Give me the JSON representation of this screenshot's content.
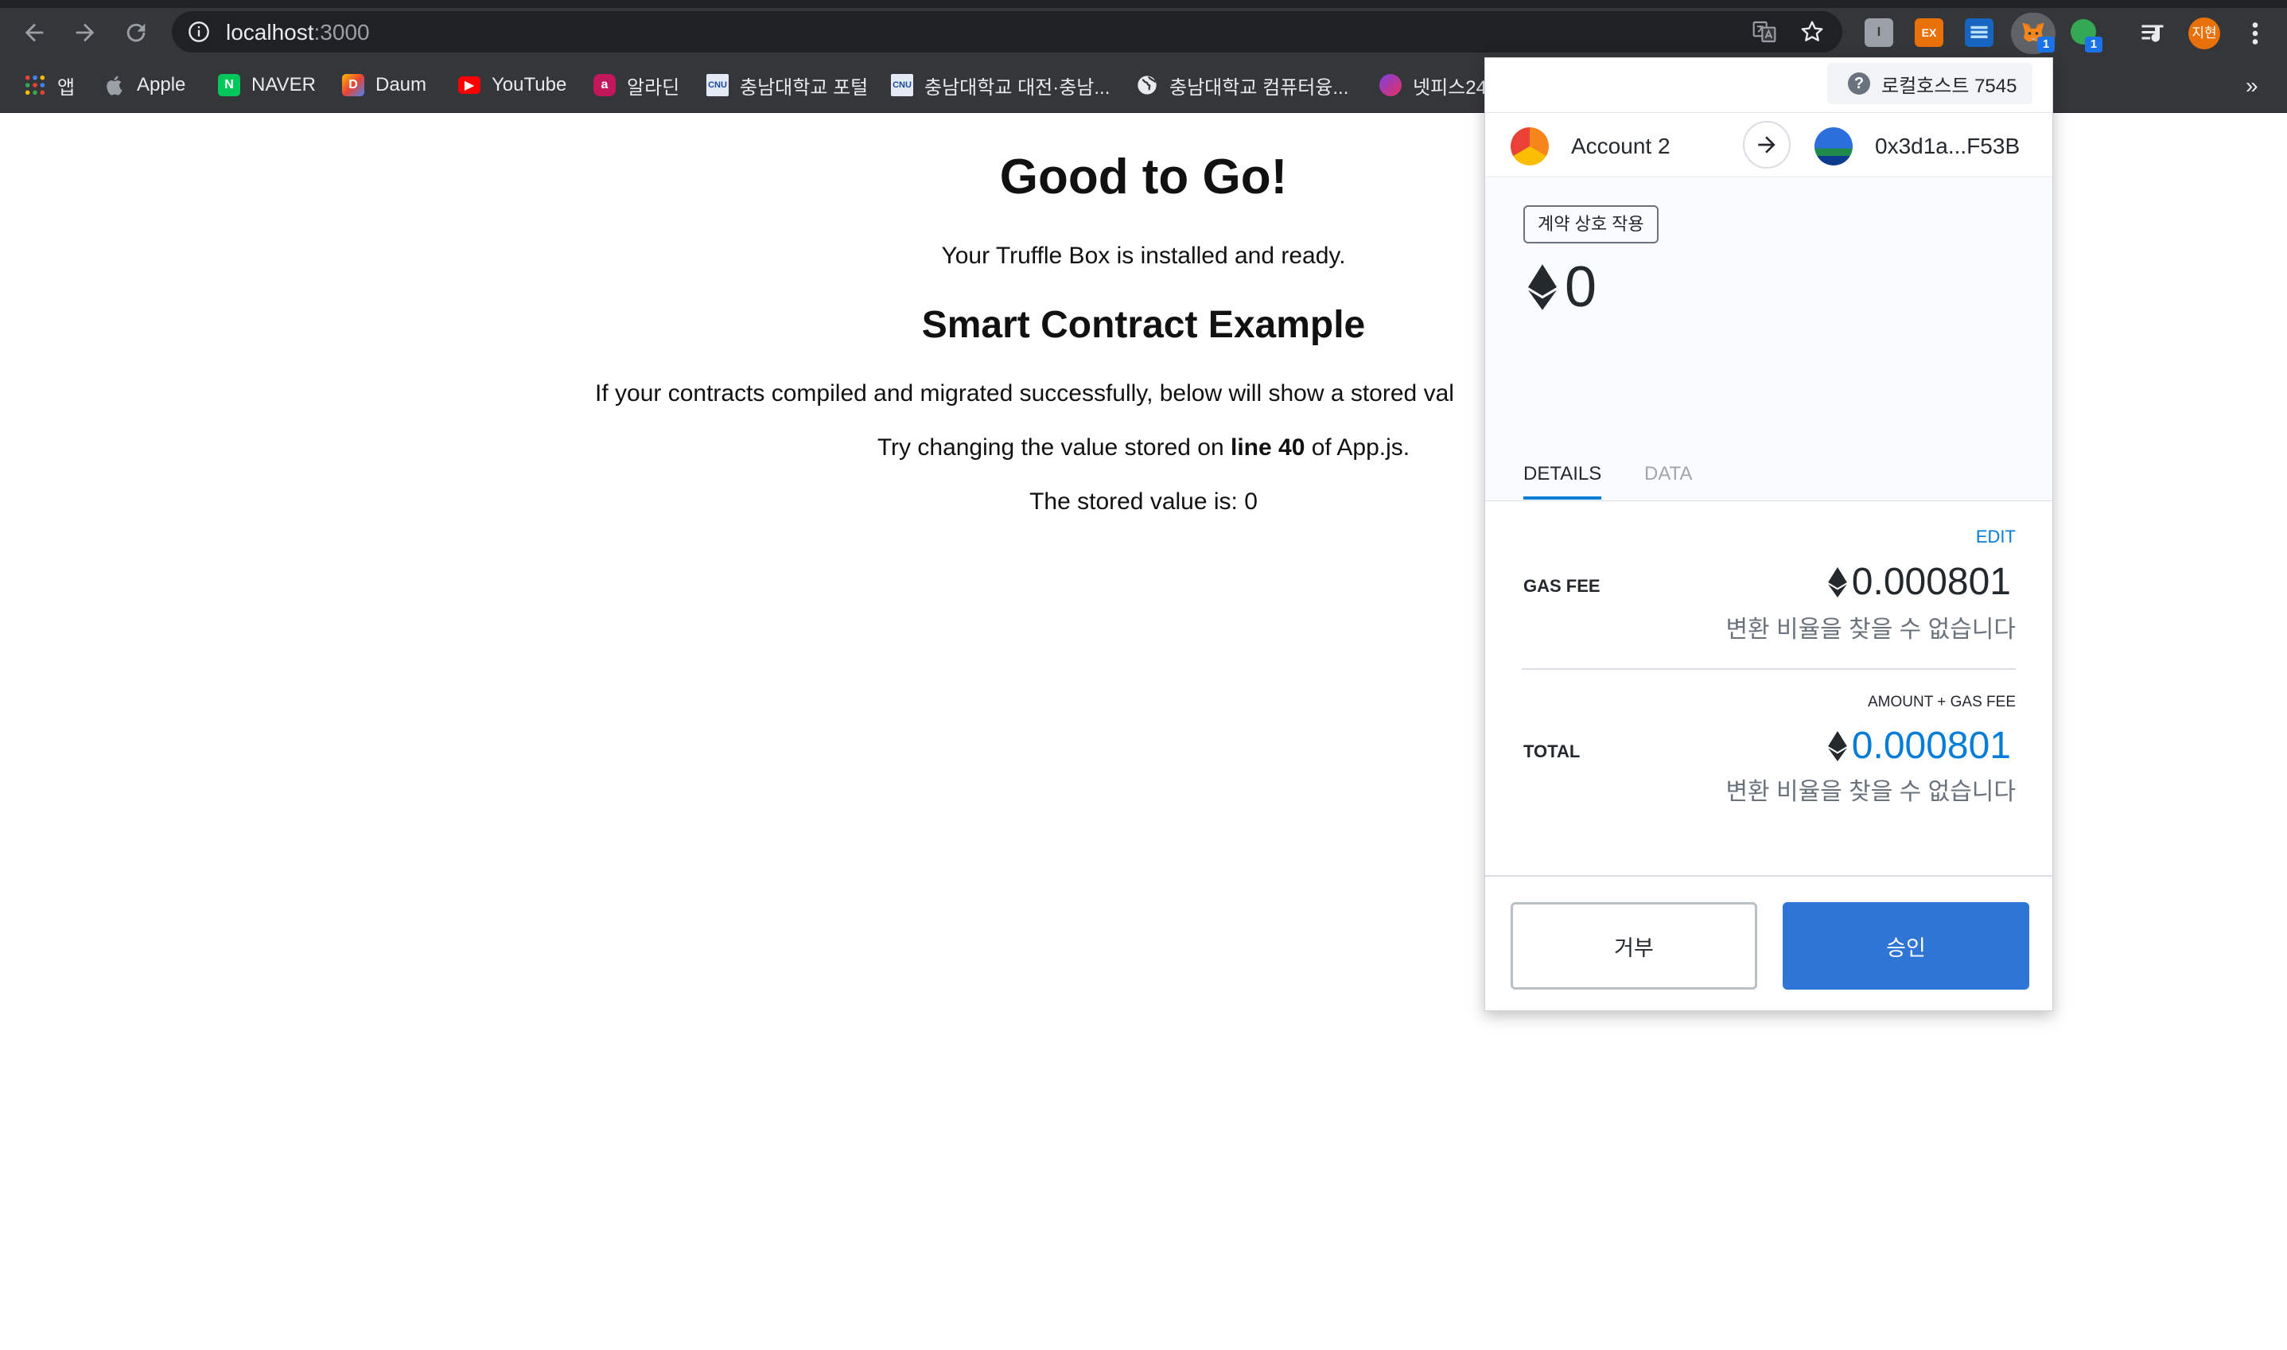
{
  "browser": {
    "url_host": "localhost",
    "url_port": ":3000",
    "profile_initials": "지현",
    "ext_badges": [
      "1",
      "1"
    ],
    "ext_labels": {
      "ex": "EX",
      "text": "I"
    },
    "bookmarks": [
      {
        "label": "앱",
        "icon": "apps-grid-icon",
        "color": "#e8eaed"
      },
      {
        "label": "Apple",
        "icon": "apple-icon",
        "color": "#9aa0a6"
      },
      {
        "label": "NAVER",
        "icon": "naver-icon",
        "color": "#03c75a"
      },
      {
        "label": "Daum",
        "icon": "daum-icon",
        "color": "#5b8df6"
      },
      {
        "label": "YouTube",
        "icon": "youtube-icon",
        "color": "#ff0000"
      },
      {
        "label": "알라딘",
        "icon": "aladin-icon",
        "color": "#c2185b"
      },
      {
        "label": "충남대학교 포털",
        "icon": "cnu-icon",
        "color": "#e3eaf5"
      },
      {
        "label": "충남대학교 대전·충남...",
        "icon": "cnu-icon",
        "color": "#e3eaf5"
      },
      {
        "label": "충남대학교 컴퓨터융...",
        "icon": "globe-icon",
        "color": "#e8eaed"
      },
      {
        "label": "넷피스24",
        "icon": "netpiece-icon",
        "color": "#7b3fe4"
      }
    ],
    "bookmarks_more": "»"
  },
  "page": {
    "title": "Good to Go!",
    "subtitle": "Your Truffle Box is installed and ready.",
    "section_title": "Smart Contract Example",
    "description": "If your contracts compiled and migrated successfully, below will show a stored val",
    "hint_pre": "Try changing the value stored on ",
    "hint_bold": "line 40",
    "hint_post": " of App.js.",
    "stored_value": "The stored value is: 0"
  },
  "metamask": {
    "network": "로컬호스트 7545",
    "help_glyph": "?",
    "from_account": "Account 2",
    "to_address": "0x3d1a...F53B",
    "method": "계약 상호 작용",
    "amount": "0",
    "tabs": [
      "DETAILS",
      "DATA"
    ],
    "active_tab": "DETAILS",
    "edit_label": "EDIT",
    "gas_fee_label": "GAS FEE",
    "gas_fee_value": "0.000801",
    "gas_fee_sub": "변환 비율을 찾을 수 없습니다",
    "total_hint": "AMOUNT + GAS FEE",
    "total_label": "TOTAL",
    "total_value": "0.000801",
    "total_sub": "변환 비율을 찾을 수 없습니다",
    "reject_label": "거부",
    "approve_label": "승인",
    "accent_color": "#037dd6",
    "approve_color": "#2f75d6"
  }
}
